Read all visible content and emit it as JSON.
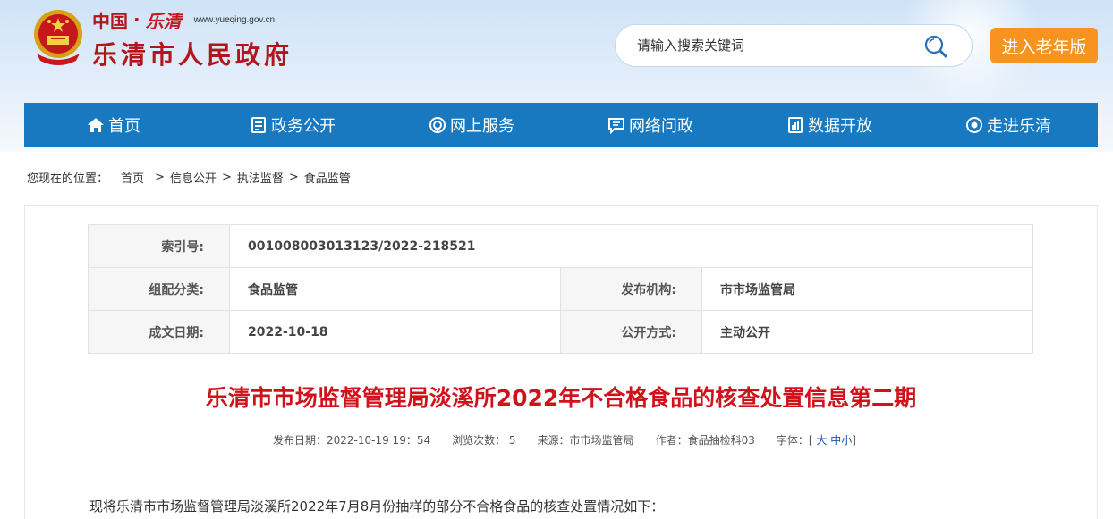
{
  "header": {
    "logo_country": "中国",
    "logo_dot": "·",
    "logo_city_script": "乐清",
    "logo_url": "www.yueqing.gov.cn",
    "logo_name": "乐清市人民政府",
    "search_placeholder": "请输入搜索关键词",
    "elder_mode_label": "进入老年版"
  },
  "nav": {
    "items": [
      {
        "label": "首页",
        "icon": "home-icon"
      },
      {
        "label": "政务公开",
        "icon": "document-icon"
      },
      {
        "label": "网上服务",
        "icon": "service-icon"
      },
      {
        "label": "网络问政",
        "icon": "chat-icon"
      },
      {
        "label": "数据开放",
        "icon": "data-icon"
      },
      {
        "label": "走进乐清",
        "icon": "eye-icon"
      }
    ]
  },
  "breadcrumb": {
    "prefix": "您现在的位置：",
    "items": [
      "首页",
      "信息公开",
      "执法监督",
      "食品监管"
    ],
    "sep": ">"
  },
  "meta": {
    "index_label": "索引号:",
    "index_value": "001008003013123/2022-218521",
    "category_label": "组配分类:",
    "category_value": "食品监管",
    "publisher_label": "发布机构:",
    "publisher_value": "市市场监管局",
    "date_label": "成文日期:",
    "date_value": "2022-10-18",
    "method_label": "公开方式:",
    "method_value": "主动公开"
  },
  "article": {
    "title": "乐清市市场监督管理局淡溪所2022年不合格食品的核查处置信息第二期",
    "publish_date": "发布日期：2022-10-19 19：54",
    "views": "浏览次数：  5",
    "source": "来源：市市场监管局",
    "author": "作者：食品抽检科03",
    "fontsize_label": "字体：",
    "fontsize_open": "[",
    "fontsize_large": "大",
    "fontsize_medium": "中",
    "fontsize_small": "小",
    "fontsize_close": "]",
    "intro": "现将乐清市市场监督管理局淡溪所2022年7月8月份抽样的部分不合格食品的核查处置情况如下："
  },
  "colors": {
    "nav_bg": "#1878c0",
    "title_red": "#d2121b",
    "elder_orange": "#f7931e",
    "logo_red": "#b3151b"
  }
}
